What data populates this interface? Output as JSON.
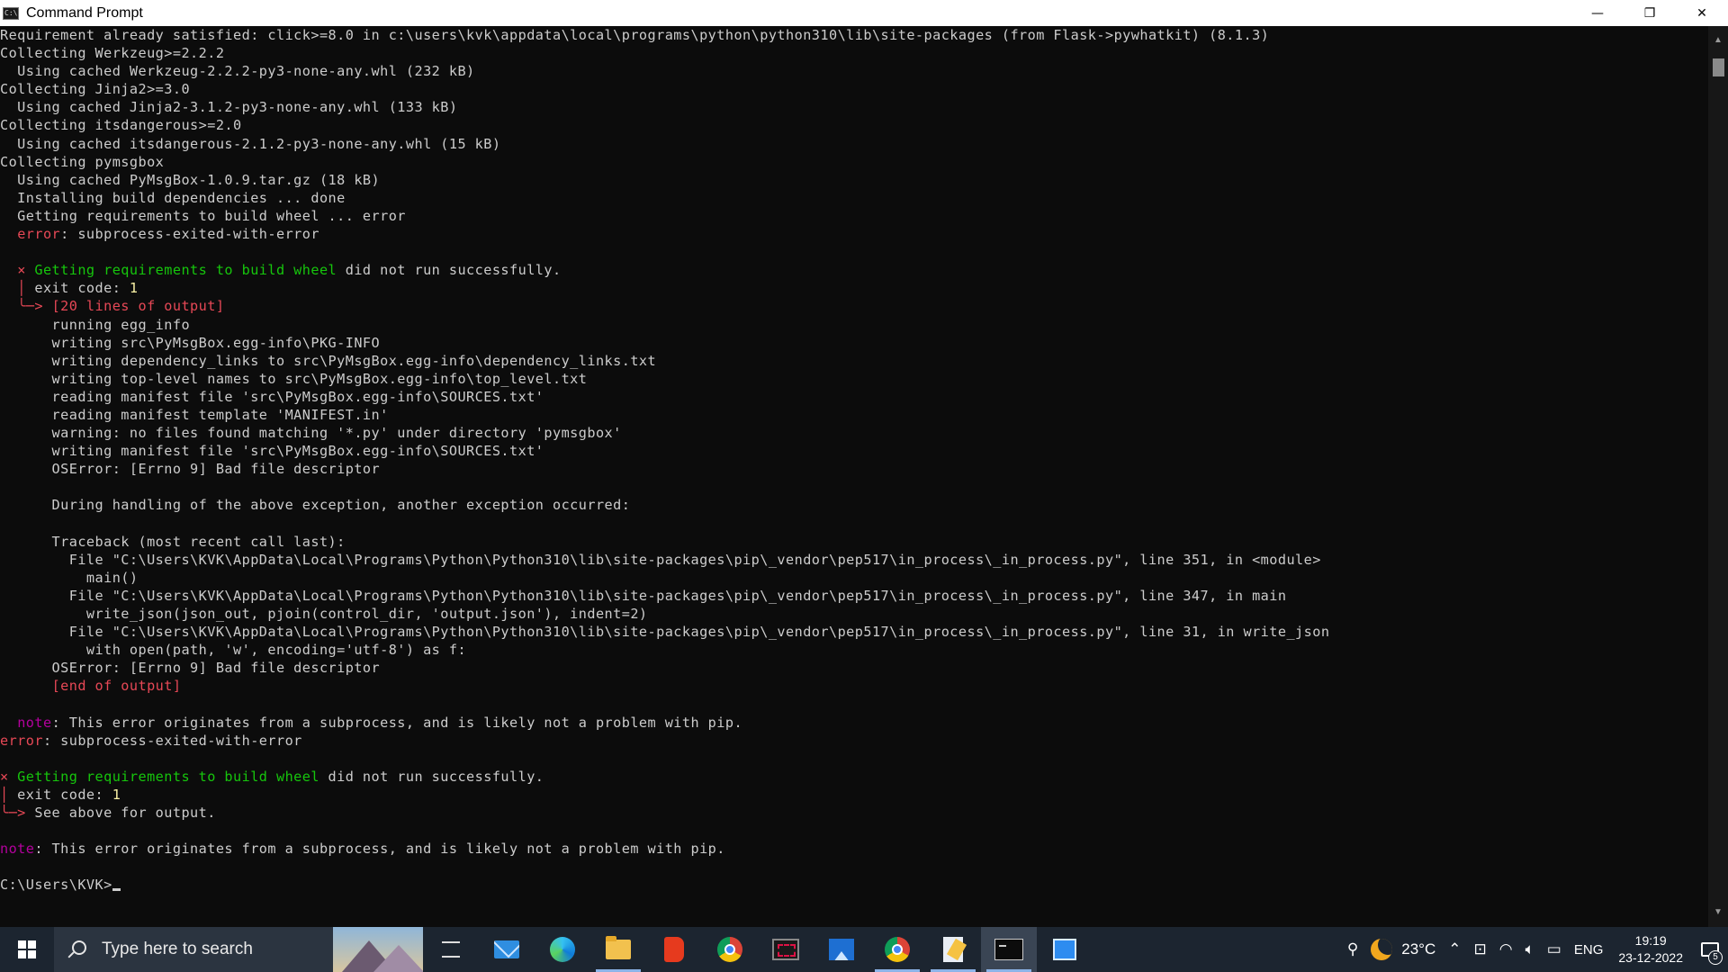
{
  "window": {
    "title": "Command Prompt",
    "controls": {
      "minimize": "—",
      "restore": "❐",
      "close": "✕"
    }
  },
  "console": {
    "lines": [
      [
        {
          "t": "Requirement already satisfied: click>=8.0 in c:\\users\\kvk\\appdata\\local\\programs\\python\\python310\\lib\\site-packages (from Flask->pywhatkit) (8.1.3)"
        }
      ],
      [
        {
          "t": "Collecting Werkzeug>=2.2.2"
        }
      ],
      [
        {
          "t": "  Using cached Werkzeug-2.2.2-py3-none-any.whl (232 kB)"
        }
      ],
      [
        {
          "t": "Collecting Jinja2>=3.0"
        }
      ],
      [
        {
          "t": "  Using cached Jinja2-3.1.2-py3-none-any.whl (133 kB)"
        }
      ],
      [
        {
          "t": "Collecting itsdangerous>=2.0"
        }
      ],
      [
        {
          "t": "  Using cached itsdangerous-2.1.2-py3-none-any.whl (15 kB)"
        }
      ],
      [
        {
          "t": "Collecting pymsgbox"
        }
      ],
      [
        {
          "t": "  Using cached PyMsgBox-1.0.9.tar.gz (18 kB)"
        }
      ],
      [
        {
          "t": "  Installing build dependencies ... done"
        }
      ],
      [
        {
          "t": "  Getting requirements to build wheel ... error"
        }
      ],
      [
        {
          "t": "  "
        },
        {
          "t": "error",
          "c": "r"
        },
        {
          "t": ": subprocess-exited-with-error"
        }
      ],
      [
        {
          "t": ""
        }
      ],
      [
        {
          "t": "  "
        },
        {
          "t": "×",
          "c": "r"
        },
        {
          "t": " Getting requirements to build wheel",
          "c": "g"
        },
        {
          "t": " did not run successfully."
        }
      ],
      [
        {
          "t": "  "
        },
        {
          "t": "│",
          "c": "r"
        },
        {
          "t": " exit code: "
        },
        {
          "t": "1",
          "c": "y"
        }
      ],
      [
        {
          "t": "  "
        },
        {
          "t": "╰─>",
          "c": "r"
        },
        {
          "t": " "
        },
        {
          "t": "[20 lines of output]",
          "c": "r"
        }
      ],
      [
        {
          "t": "      running egg_info"
        }
      ],
      [
        {
          "t": "      writing src\\PyMsgBox.egg-info\\PKG-INFO"
        }
      ],
      [
        {
          "t": "      writing dependency_links to src\\PyMsgBox.egg-info\\dependency_links.txt"
        }
      ],
      [
        {
          "t": "      writing top-level names to src\\PyMsgBox.egg-info\\top_level.txt"
        }
      ],
      [
        {
          "t": "      reading manifest file 'src\\PyMsgBox.egg-info\\SOURCES.txt'"
        }
      ],
      [
        {
          "t": "      reading manifest template 'MANIFEST.in'"
        }
      ],
      [
        {
          "t": "      warning: no files found matching '*.py' under directory 'pymsgbox'"
        }
      ],
      [
        {
          "t": "      writing manifest file 'src\\PyMsgBox.egg-info\\SOURCES.txt'"
        }
      ],
      [
        {
          "t": "      OSError: [Errno 9] Bad file descriptor"
        }
      ],
      [
        {
          "t": ""
        }
      ],
      [
        {
          "t": "      During handling of the above exception, another exception occurred:"
        }
      ],
      [
        {
          "t": ""
        }
      ],
      [
        {
          "t": "      Traceback (most recent call last):"
        }
      ],
      [
        {
          "t": "        File \"C:\\Users\\KVK\\AppData\\Local\\Programs\\Python\\Python310\\lib\\site-packages\\pip\\_vendor\\pep517\\in_process\\_in_process.py\", line 351, in <module>"
        }
      ],
      [
        {
          "t": "          main()"
        }
      ],
      [
        {
          "t": "        File \"C:\\Users\\KVK\\AppData\\Local\\Programs\\Python\\Python310\\lib\\site-packages\\pip\\_vendor\\pep517\\in_process\\_in_process.py\", line 347, in main"
        }
      ],
      [
        {
          "t": "          write_json(json_out, pjoin(control_dir, 'output.json'), indent=2)"
        }
      ],
      [
        {
          "t": "        File \"C:\\Users\\KVK\\AppData\\Local\\Programs\\Python\\Python310\\lib\\site-packages\\pip\\_vendor\\pep517\\in_process\\_in_process.py\", line 31, in write_json"
        }
      ],
      [
        {
          "t": "          with open(path, 'w', encoding='utf-8') as f:"
        }
      ],
      [
        {
          "t": "      OSError: [Errno 9] Bad file descriptor"
        }
      ],
      [
        {
          "t": "      "
        },
        {
          "t": "[end of output]",
          "c": "r"
        }
      ],
      [
        {
          "t": ""
        }
      ],
      [
        {
          "t": "  "
        },
        {
          "t": "note",
          "c": "m"
        },
        {
          "t": ": This error originates from a subprocess, and is likely not a problem with pip."
        }
      ],
      [
        {
          "t": "error",
          "c": "r"
        },
        {
          "t": ": subprocess-exited-with-error"
        }
      ],
      [
        {
          "t": ""
        }
      ],
      [
        {
          "t": "×",
          "c": "r"
        },
        {
          "t": " Getting requirements to build wheel",
          "c": "g"
        },
        {
          "t": " did not run successfully."
        }
      ],
      [
        {
          "t": "│",
          "c": "r"
        },
        {
          "t": " exit code: "
        },
        {
          "t": "1",
          "c": "y"
        }
      ],
      [
        {
          "t": "╰─>",
          "c": "r"
        },
        {
          "t": " See above for output."
        }
      ],
      [
        {
          "t": ""
        }
      ],
      [
        {
          "t": "note",
          "c": "m"
        },
        {
          "t": ": This error originates from a subprocess, and is likely not a problem with pip."
        }
      ],
      [
        {
          "t": ""
        }
      ],
      [
        {
          "t": "C:\\Users\\KVK>"
        }
      ]
    ]
  },
  "taskbar": {
    "search_placeholder": "Type here to search",
    "apps": [
      {
        "name": "task-view",
        "label": "Task View"
      },
      {
        "name": "mail",
        "label": "Mail"
      },
      {
        "name": "edge",
        "label": "Microsoft Edge"
      },
      {
        "name": "file-explorer",
        "label": "File Explorer"
      },
      {
        "name": "office",
        "label": "Office"
      },
      {
        "name": "chrome",
        "label": "Google Chrome"
      },
      {
        "name": "snipping-tool",
        "label": "Snipping Tool"
      },
      {
        "name": "photos",
        "label": "Photos"
      },
      {
        "name": "chrome-profile",
        "label": "Google Chrome"
      },
      {
        "name": "notepad",
        "label": "Notepad"
      },
      {
        "name": "command-prompt",
        "label": "Command Prompt"
      },
      {
        "name": "blue-app",
        "label": "App"
      }
    ],
    "tray": {
      "temperature": "23°C",
      "language": "ENG",
      "time": "19:19",
      "date": "23-12-2022",
      "notifications": "5"
    }
  },
  "colors": {
    "console_bg": "#0c0c0c",
    "console_text": "#cccccc",
    "green": "#16c60c",
    "red": "#e74856",
    "magenta": "#b4009e",
    "taskbar_bg": "#1c2530"
  },
  "icons": [
    "cmd-icon",
    "windows-logo-icon",
    "search-icon",
    "weather-moon-icon",
    "people-icon",
    "chevron-up-icon",
    "network-icon",
    "volume-icon",
    "battery-icon",
    "notification-icon"
  ]
}
